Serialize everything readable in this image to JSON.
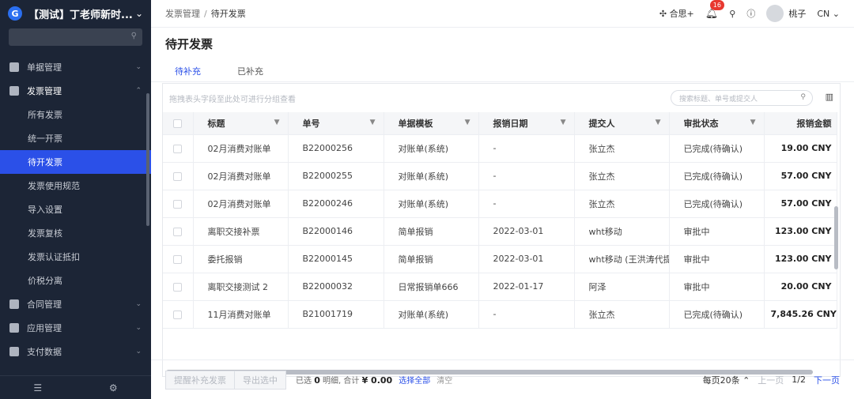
{
  "app": {
    "title": "【测试】丁老师新时...",
    "logo_letter": "G"
  },
  "sidebar": {
    "menus": [
      {
        "label": "单据管理",
        "arrow": "⌄",
        "open": false
      },
      {
        "label": "发票管理",
        "arrow": "⌃",
        "open": true
      }
    ],
    "submenu": [
      {
        "label": "所有发票",
        "active": false
      },
      {
        "label": "统一开票",
        "active": false
      },
      {
        "label": "待开发票",
        "active": true
      },
      {
        "label": "发票使用规范",
        "active": false
      },
      {
        "label": "导入设置",
        "active": false
      },
      {
        "label": "发票复核",
        "active": false
      },
      {
        "label": "发票认证抵扣",
        "active": false
      },
      {
        "label": "价税分离",
        "active": false
      }
    ],
    "menus_after": [
      {
        "label": "合同管理",
        "arrow": "⌄"
      },
      {
        "label": "应用管理",
        "arrow": "⌄"
      },
      {
        "label": "支付数据",
        "arrow": "⌄"
      }
    ]
  },
  "topbar": {
    "breadcrumb": [
      "发票管理",
      "待开发票"
    ],
    "hexi_label": "合思+",
    "notification_count": "16",
    "user_name": "桃子",
    "lang": "CN"
  },
  "page": {
    "title": "待开发票",
    "tabs": [
      {
        "label": "待补充",
        "active": true
      },
      {
        "label": "已补充",
        "active": false
      }
    ],
    "group_hint": "拖拽表头字段至此处可进行分组查看",
    "search_placeholder": "搜索标题、单号或提交人"
  },
  "table": {
    "columns": [
      "标题",
      "单号",
      "单据模板",
      "报销日期",
      "提交人",
      "审批状态",
      "报销金额"
    ],
    "rows": [
      [
        "02月消费对账单",
        "B22000256",
        "对账单(系统)",
        "-",
        "张立杰",
        "已完成(待确认)",
        "19.00 CNY"
      ],
      [
        "02月消费对账单",
        "B22000255",
        "对账单(系统)",
        "-",
        "张立杰",
        "已完成(待确认)",
        "57.00 CNY"
      ],
      [
        "02月消费对账单",
        "B22000246",
        "对账单(系统)",
        "-",
        "张立杰",
        "已完成(待确认)",
        "57.00 CNY"
      ],
      [
        "离职交接补票",
        "B22000146",
        "简单报销",
        "2022-03-01",
        "wht移动",
        "审批中",
        "123.00 CNY"
      ],
      [
        "委托报销",
        "B22000145",
        "简单报销",
        "2022-03-01",
        "wht移动 (王洪涛代提交)",
        "审批中",
        "123.00 CNY"
      ],
      [
        "离职交接测试 2",
        "B22000032",
        "日常报销单666",
        "2022-01-17",
        "阿泽",
        "审批中",
        "20.00 CNY"
      ],
      [
        "11月消费对账单",
        "B21001719",
        "对账单(系统)",
        "-",
        "张立杰",
        "已完成(待确认)",
        "7,845.26 CNY"
      ]
    ]
  },
  "footer": {
    "btn_remind": "提醒补充发票",
    "btn_export": "导出选中",
    "selected_prefix": "已选",
    "selected_count": "0",
    "detail_label": "明细, 合计",
    "total": "¥ 0.00",
    "select_all": "选择全部",
    "clear": "清空",
    "page_size": "每页20条 ⌃",
    "prev": "上一页",
    "page_info": "1/2",
    "next": "下一页"
  }
}
